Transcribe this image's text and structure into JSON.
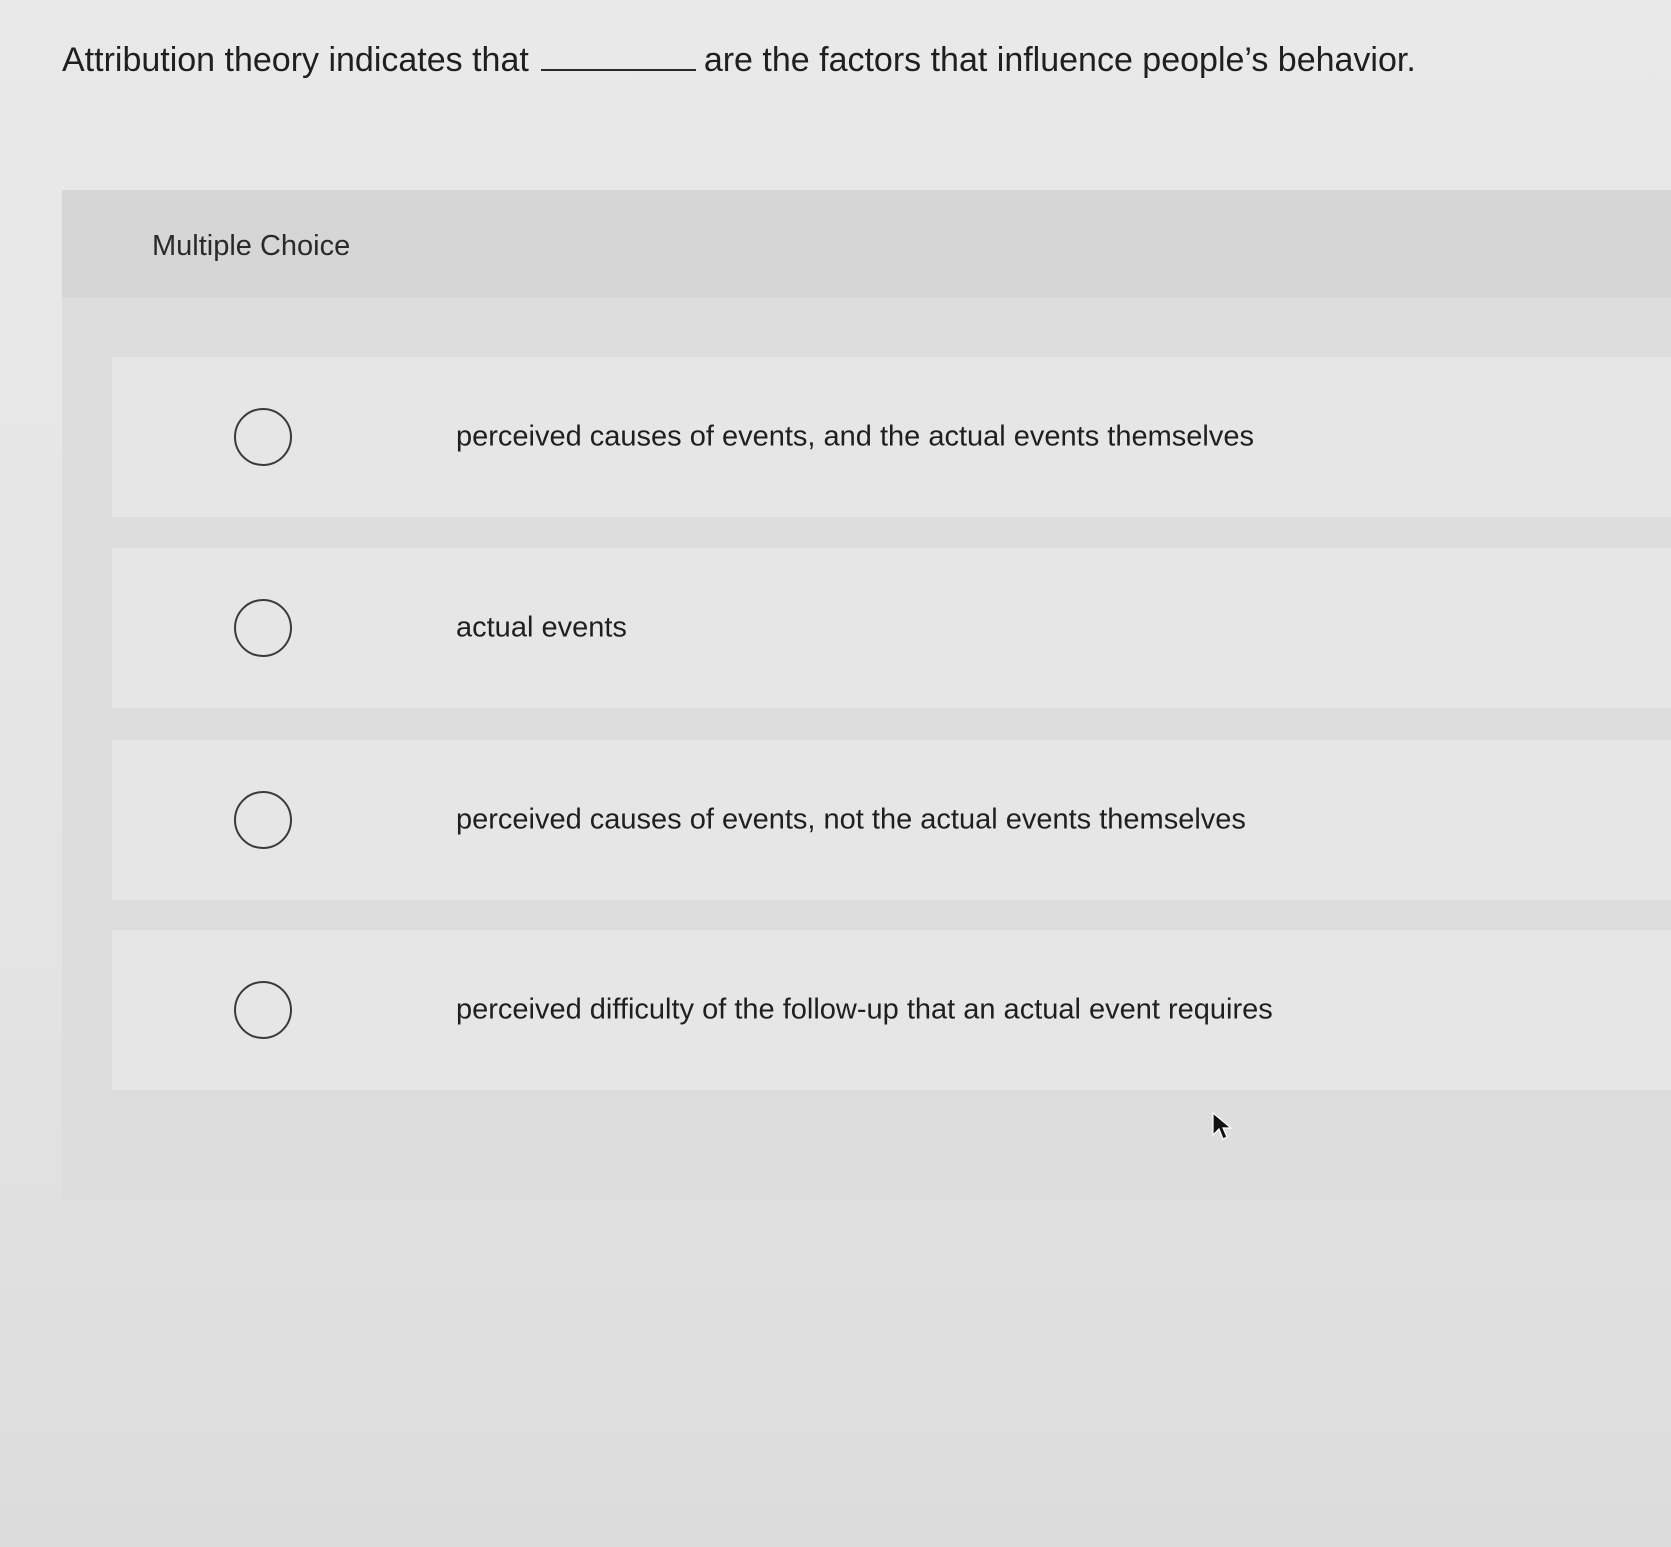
{
  "question": {
    "before_blank": "Attribution theory indicates that",
    "after_blank": "are the factors that influence people’s behavior."
  },
  "panel": {
    "label": "Multiple Choice"
  },
  "options": [
    {
      "text": "perceived causes of events, and the actual events themselves"
    },
    {
      "text": "actual events"
    },
    {
      "text": "perceived causes of events, not the actual events themselves"
    },
    {
      "text": "perceived difficulty of the follow-up that an actual event requires"
    }
  ],
  "icons": {
    "radio": "radio-circle-icon",
    "cursor": "mouse-pointer-icon"
  },
  "colors": {
    "background": "#e6e6e6",
    "panel": "#dddddd",
    "text": "#1f1f1f"
  }
}
